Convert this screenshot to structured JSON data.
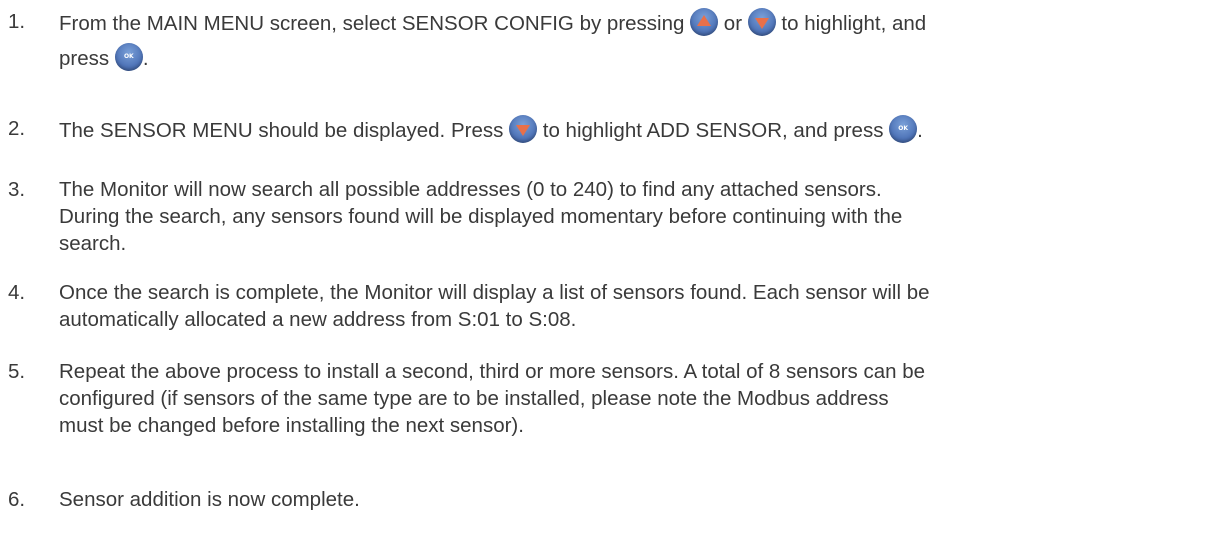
{
  "steps": [
    {
      "num": "1.",
      "parts": {
        "a": "From the MAIN MENU screen, select SENSOR CONFIG by pressing ",
        "b": " or ",
        "c": "  to highlight, and",
        "d": "press ",
        "e": "."
      }
    },
    {
      "num": "2.",
      "parts": {
        "a": "The SENSOR MENU should be displayed. Press ",
        "b": " to highlight ADD SENSOR, and press ",
        "c": "."
      }
    },
    {
      "num": "3.",
      "lines": [
        "The Monitor will now search all possible addresses (0 to 240) to find any attached sensors.",
        "During the search, any sensors found will be displayed momentary before continuing with the",
        "search."
      ]
    },
    {
      "num": "4.",
      "lines": [
        "Once the search is complete, the Monitor will display a list of sensors found. Each sensor will be",
        "automatically allocated a new address from S:01 to S:08."
      ]
    },
    {
      "num": "5.",
      "lines": [
        "Repeat the above process to install a second, third or more sensors. A total of 8 sensors can be",
        "configured (if sensors of the same type are to be installed, please note the Modbus address",
        "must be changed before installing the next sensor)."
      ]
    },
    {
      "num": "6.",
      "lines": [
        "Sensor addition is now complete."
      ]
    }
  ],
  "icons": {
    "up_button": "up-arrow-button-icon",
    "down_button": "down-arrow-button-icon",
    "ok_button": "ok-button-icon",
    "ok_label": "OK",
    "button_color": "#4f74b8",
    "arrow_color": "#e8704a"
  }
}
